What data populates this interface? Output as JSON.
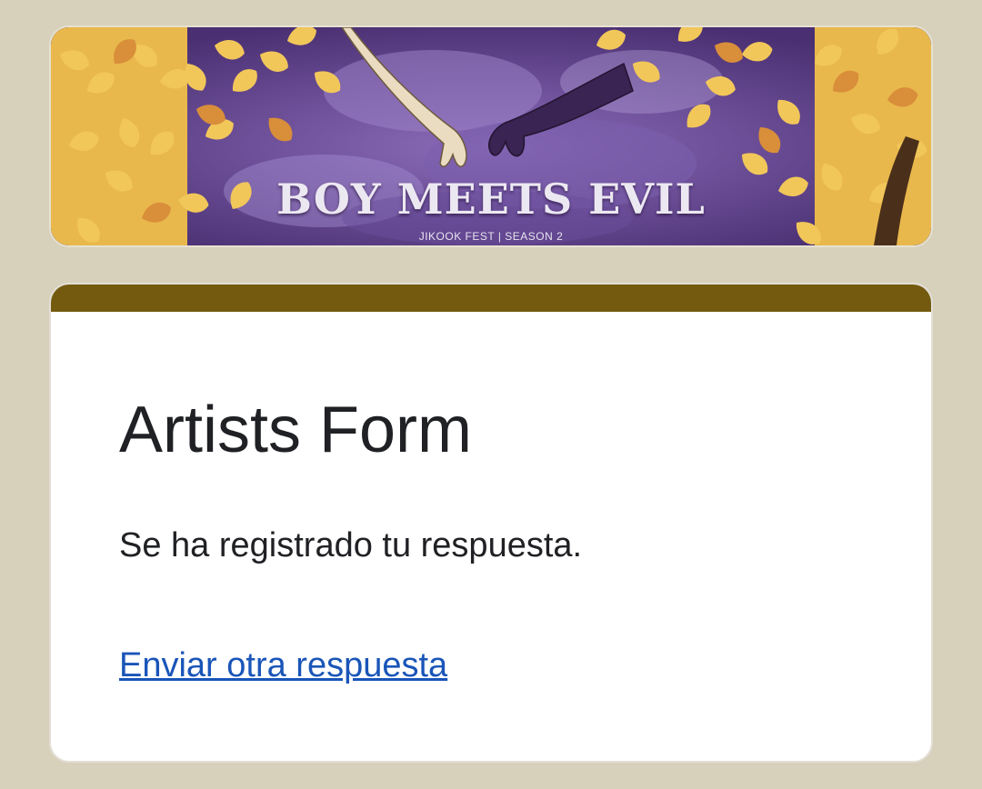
{
  "header_banner": {
    "title": "BOY MEETS EVIL",
    "subtitle": "JIKOOK FEST  |  SEASON 2"
  },
  "form": {
    "title": "Artists Form",
    "confirmation": "Se ha registrado tu respuesta.",
    "submit_another_link": "Enviar otra respuesta"
  },
  "colors": {
    "page_background": "#d7d0bb",
    "accent_bar": "#735a0f",
    "link": "#1a55b8",
    "banner_purple": "#5b3f86",
    "banner_leaves": "#f2c75a"
  }
}
